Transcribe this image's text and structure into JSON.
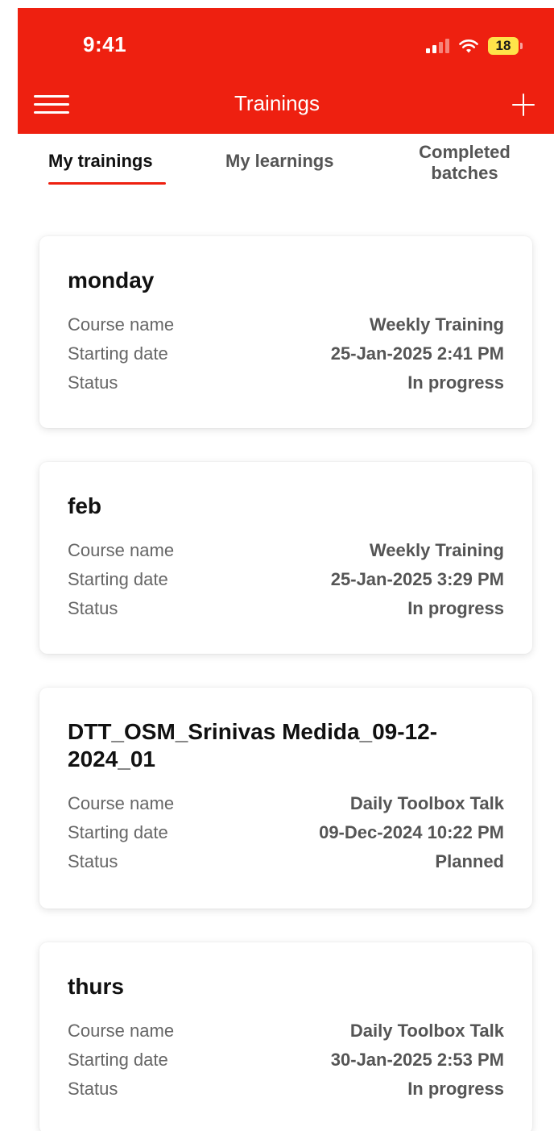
{
  "status_bar": {
    "time": "9:41",
    "battery": "18"
  },
  "header": {
    "title": "Trainings"
  },
  "tabs": [
    {
      "label": "My trainings",
      "active": true
    },
    {
      "label": "My learnings",
      "active": false
    },
    {
      "label": "Completed batches",
      "active": false
    }
  ],
  "labels": {
    "course": "Course name",
    "start": "Starting date",
    "status": "Status"
  },
  "trainings": [
    {
      "title": "monday",
      "course": "Weekly Training",
      "start": "25-Jan-2025 2:41 PM",
      "status": "In progress"
    },
    {
      "title": "feb",
      "course": "Weekly Training",
      "start": "25-Jan-2025 3:29 PM",
      "status": "In progress"
    },
    {
      "title": "DTT_OSM_Srinivas Medida_09-12-2024_01",
      "course": "Daily Toolbox Talk",
      "start": "09-Dec-2024 10:22 PM",
      "status": "Planned"
    },
    {
      "title": "thurs",
      "course": "Daily Toolbox Talk",
      "start": "30-Jan-2025 2:53 PM",
      "status": "In progress"
    }
  ],
  "colors": {
    "brand": "#EE2010",
    "battery": "#FFE34A"
  },
  "icons": {
    "menu": "hamburger-menu-icon",
    "add": "plus-icon",
    "signal": "cellular-signal-icon",
    "wifi": "wifi-icon",
    "battery": "battery-icon"
  }
}
